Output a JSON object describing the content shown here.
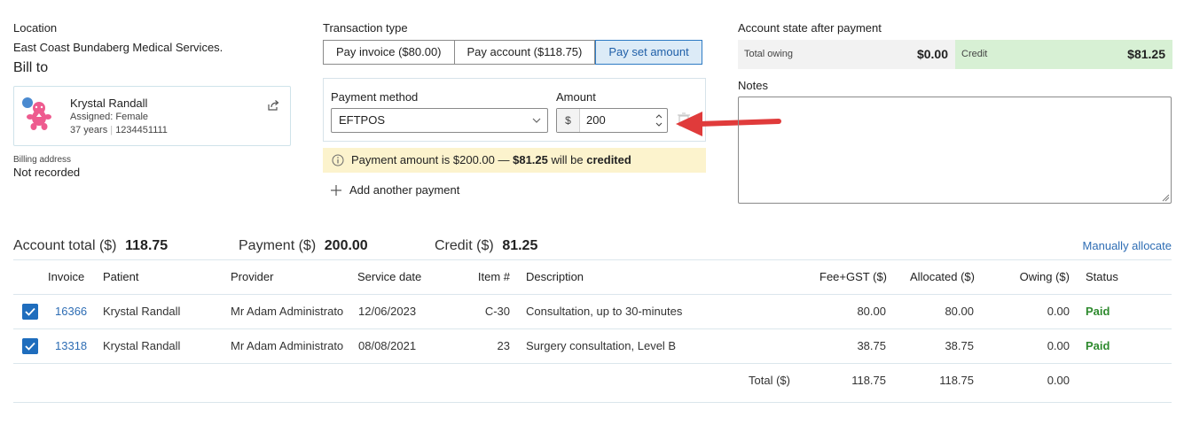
{
  "left": {
    "location_label": "Location",
    "location_value": "East Coast Bundaberg Medical Services.",
    "bill_to_label": "Bill to",
    "patient": {
      "name": "Krystal Randall",
      "gender": "Assigned: Female",
      "age": "37 years",
      "id": "1234451111"
    },
    "billing_label": "Billing address",
    "billing_value": "Not recorded"
  },
  "transaction": {
    "label": "Transaction type",
    "options": [
      "Pay invoice ($80.00)",
      "Pay account ($118.75)",
      "Pay set amount"
    ],
    "selected": "Pay set amount"
  },
  "payment": {
    "method_label": "Payment method",
    "method_value": "EFTPOS",
    "amount_label": "Amount",
    "amount_prefix": "$",
    "amount_value": "200",
    "notice_pre": "Payment amount is $200.00 — ",
    "notice_amount": "$81.25",
    "notice_mid": " will be ",
    "notice_post": "credited",
    "add_label": "Add another payment"
  },
  "account_state": {
    "label": "Account state after payment",
    "owing_label": "Total owing",
    "owing_value": "$0.00",
    "credit_label": "Credit",
    "credit_value": "$81.25",
    "notes_label": "Notes",
    "notes_value": ""
  },
  "summary": {
    "account_total_label": "Account total ($)",
    "account_total_value": "118.75",
    "payment_label": "Payment ($)",
    "payment_value": "200.00",
    "credit_label": "Credit ($)",
    "credit_value": "81.25",
    "manual_link": "Manually allocate"
  },
  "table": {
    "headers": [
      "Invoice",
      "Patient",
      "Provider",
      "Service date",
      "Item #",
      "Description",
      "Fee+GST ($)",
      "Allocated ($)",
      "Owing ($)",
      "Status"
    ],
    "rows": [
      {
        "invoice": "16366",
        "patient": "Krystal Randall",
        "provider": "Mr Adam Administrato",
        "date": "12/06/2023",
        "item": "C-30",
        "description": "Consultation, up to 30-minutes",
        "fee": "80.00",
        "allocated": "80.00",
        "owing": "0.00",
        "status": "Paid",
        "checked": true
      },
      {
        "invoice": "13318",
        "patient": "Krystal Randall",
        "provider": "Mr Adam Administrato",
        "date": "08/08/2021",
        "item": "23",
        "description": "Surgery consultation, Level B",
        "fee": "38.75",
        "allocated": "38.75",
        "owing": "0.00",
        "status": "Paid",
        "checked": true
      }
    ],
    "total_label": "Total ($)",
    "total_fee": "118.75",
    "total_allocated": "118.75",
    "total_owing": "0.00"
  },
  "colors": {
    "accent": "#2e7bc4",
    "credit_bg": "#d7f0d4",
    "notice_bg": "#fcf3cd",
    "paid": "#2e8a2e",
    "arrow": "#e03b3b"
  },
  "icons": [
    "share-icon",
    "chevron-down-icon",
    "spin-icon",
    "delete-icon",
    "info-icon",
    "plus-icon",
    "checkbox-icon",
    "arrow-icon"
  ]
}
